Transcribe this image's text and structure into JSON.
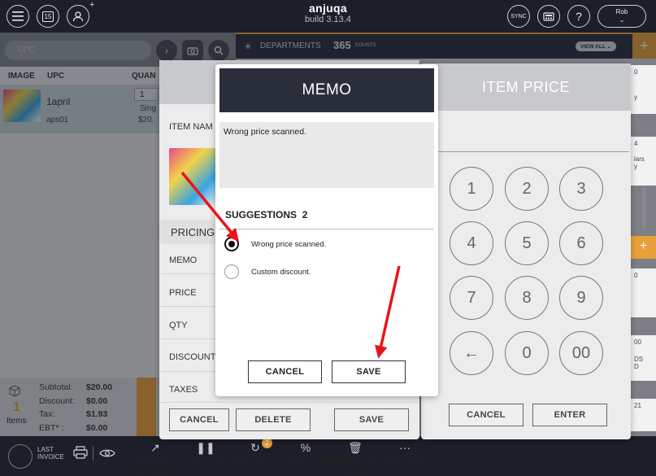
{
  "header": {
    "app_name": "anjuqa",
    "build": "build 3.13.4",
    "calendar_day": "15",
    "sync_label": "SYNC",
    "user_name": "Rob"
  },
  "search": {
    "placeholder": "UPC"
  },
  "departments": {
    "label": "DEPARTMENTS",
    "count": "365",
    "count_unit": "COUNTS",
    "view_all": "VIEW ALL"
  },
  "table": {
    "columns": [
      "IMAGE",
      "UPC",
      "QUAN"
    ],
    "row": {
      "name": "1april",
      "code": "aps01",
      "qty": "1",
      "sub": "Sing",
      "price": "$20."
    }
  },
  "summary": {
    "count": "1",
    "count_label": "Items",
    "rows": [
      {
        "label": "Subtotal:",
        "value": "$20.00"
      },
      {
        "label": "Discount:",
        "value": "$0.00"
      },
      {
        "label": "Tax:",
        "value": "$1.93"
      },
      {
        "label": "EBT* :",
        "value": "$0.00"
      }
    ]
  },
  "bottom_nav": {
    "last_invoice": "LAST INVOICE",
    "items": [
      "SEND ORDER",
      "HOLD",
      "RECALL",
      "DISCOUNT",
      "CANCEL TNX",
      "MORE"
    ],
    "recall_badge": "2"
  },
  "item_panel": {
    "item_name_label": "ITEM NAM",
    "pricing_label": "PRICING",
    "rows": [
      "MEMO",
      "PRICE",
      "QTY",
      "DISCOUNT",
      "TAXES"
    ],
    "cancel": "CANCEL",
    "delete": "DELETE",
    "save": "SAVE"
  },
  "price_panel": {
    "title": "ITEM PRICE",
    "keys": [
      "1",
      "2",
      "3",
      "4",
      "5",
      "6",
      "7",
      "8",
      "9",
      "←",
      "0",
      "00"
    ],
    "cancel": "CANCEL",
    "enter": "ENTER"
  },
  "memo": {
    "title": "MEMO",
    "text": "Wrong price scanned.",
    "suggestions_label": "SUGGESTIONS",
    "suggestions_count": "2",
    "options": [
      {
        "label": "Wrong price scanned.",
        "selected": true
      },
      {
        "label": "Custom discount.",
        "selected": false
      }
    ],
    "cancel": "CANCEL",
    "save": "SAVE"
  },
  "right_edge": {
    "lars": "lars",
    "y": "y",
    "ds": "DS",
    "d": "D",
    "n4": "4",
    "n0a": "0",
    "n0b": "0",
    "n00": "00",
    "n21": "21",
    "n0top": "0"
  },
  "colors": {
    "accent": "#e6a13a",
    "dark": "#2a2d3a",
    "arrow": "#e8141a"
  }
}
